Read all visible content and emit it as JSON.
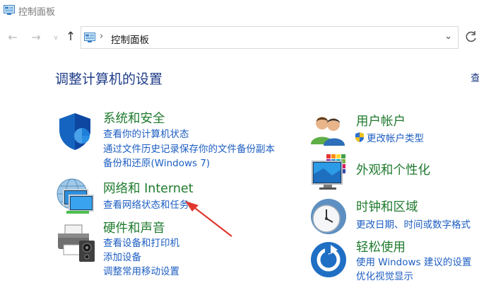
{
  "window": {
    "title": "控制面板"
  },
  "address": {
    "breadcrumb": "控制面板"
  },
  "main": {
    "heading": "调整计算机的设置",
    "view_by_partial": "查"
  },
  "categories_left": [
    {
      "title": "系统和安全",
      "links": [
        "查看你的计算机状态",
        "通过文件历史记录保存你的文件备份副本",
        "备份和还原(Windows 7)"
      ]
    },
    {
      "title": "网络和 Internet",
      "links": [
        "查看网络状态和任务"
      ]
    },
    {
      "title": "硬件和声音",
      "links": [
        "查看设备和打印机",
        "添加设备",
        "调整常用移动设置"
      ]
    }
  ],
  "categories_right": [
    {
      "title": "用户帐户",
      "links": [
        "更改帐户类型"
      ]
    },
    {
      "title": "外观和个性化",
      "links": []
    },
    {
      "title": "时钟和区域",
      "links": [
        "更改日期、时间或数字格式"
      ]
    },
    {
      "title": "轻松使用",
      "links": [
        "使用 Windows 建议的设置",
        "优化视觉显示"
      ]
    }
  ],
  "colors": {
    "category_title": "#1f7a2e",
    "link": "#1d5ec2",
    "heading": "#1e3c87",
    "annotation_arrow": "#e0382e"
  },
  "icons": {
    "system_security": "shield-icon",
    "network": "network-globe-icon",
    "hardware": "printer-icon",
    "user_accounts": "users-icon",
    "appearance": "monitor-palette-icon",
    "clock_region": "clock-icon",
    "ease_of_access": "ease-of-access-icon",
    "uac": "uac-shield-icon"
  }
}
